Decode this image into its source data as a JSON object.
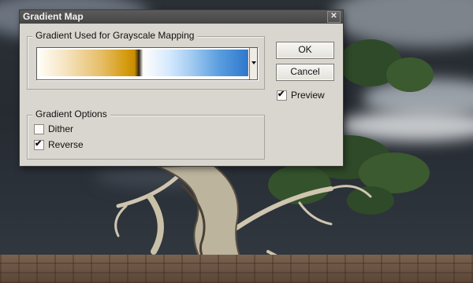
{
  "dialog": {
    "title": "Gradient Map",
    "close_glyph": "✕"
  },
  "grayscale_group": {
    "legend": "Gradient Used for Grayscale Mapping",
    "gradient_colors": [
      "#fffdf5",
      "#e6be68",
      "#c98c00",
      "#2c2418",
      "#fffdfa",
      "#a8cff2",
      "#2f78cc"
    ]
  },
  "buttons": {
    "ok_label": "OK",
    "cancel_label": "Cancel"
  },
  "preview": {
    "label": "Preview",
    "checked": true,
    "check_glyph": "✔"
  },
  "options_group": {
    "legend": "Gradient Options",
    "dither": {
      "label": "Dither",
      "checked": false,
      "check_glyph": ""
    },
    "reverse": {
      "label": "Reverse",
      "checked": true,
      "check_glyph": "✔"
    }
  },
  "icons": {
    "dropdown": "triangle-down",
    "close": "x-mark",
    "checkmark": "check"
  }
}
